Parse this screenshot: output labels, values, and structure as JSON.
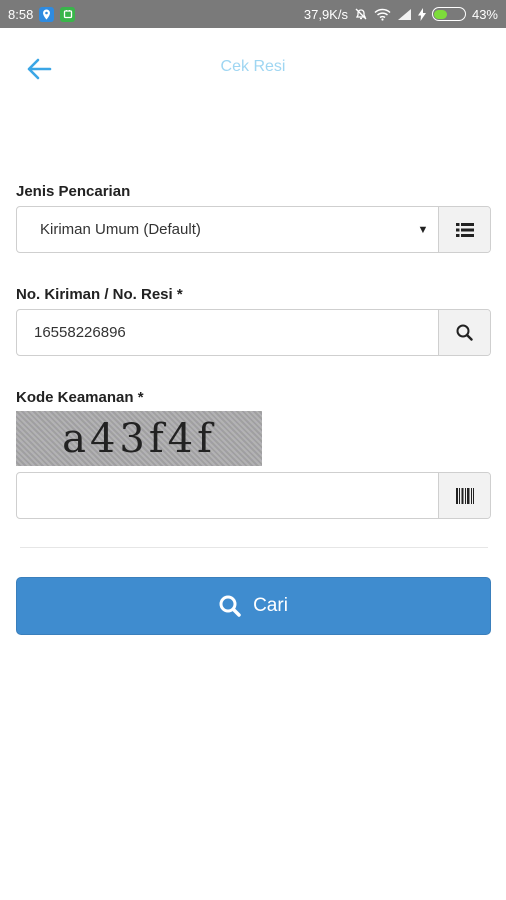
{
  "status_bar": {
    "time": "8:58",
    "network_speed": "37,9K/s",
    "battery_percent": "43%",
    "battery_level": 0.43
  },
  "header": {
    "title": "Cek Resi",
    "back_icon": "arrow-left-icon"
  },
  "form": {
    "search_type": {
      "label": "Jenis Pencarian",
      "selected_value": "Kiriman Umum (Default)",
      "addon_icon": "list-icon"
    },
    "tracking_number": {
      "label": "No. Kiriman / No. Resi *",
      "value": "16558226896",
      "addon_icon": "search-icon"
    },
    "security_code": {
      "label": "Kode Keamanan *",
      "captcha_text": "a43f4f",
      "value": "",
      "addon_icon": "barcode-icon"
    }
  },
  "submit": {
    "label": "Cari",
    "icon": "search-icon"
  },
  "colors": {
    "accent": "#3f8ccf",
    "title": "#9fd6f2",
    "back_arrow": "#3ba6e6"
  }
}
